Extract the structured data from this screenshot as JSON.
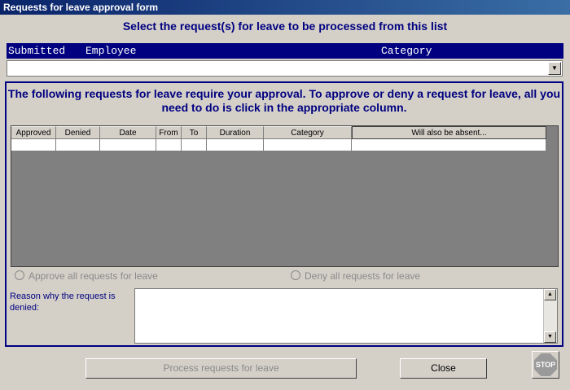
{
  "window": {
    "title": "Requests for leave approval form"
  },
  "heading": "Select the request(s) for leave to be processed from this list",
  "list_header": {
    "submitted": "Submitted",
    "employee": "Employee",
    "category": "Category"
  },
  "combo": {
    "value": "",
    "arrow_icon": "chevron-down-icon"
  },
  "intro_text": "The following requests for leave require your approval. To approve or deny a request for leave, all you need to do is click in the appropriate column.",
  "grid": {
    "columns": [
      "Approved",
      "Denied",
      "Date",
      "From",
      "To",
      "Duration",
      "Category",
      "Will also be absent..."
    ]
  },
  "options": {
    "approve_all": "Approve all requests for leave",
    "deny_all": "Deny all requests for leave"
  },
  "reason": {
    "label": "Reason why the request is denied:",
    "value": ""
  },
  "buttons": {
    "process": "Process requests for leave",
    "close": "Close",
    "stop": "STOP"
  }
}
